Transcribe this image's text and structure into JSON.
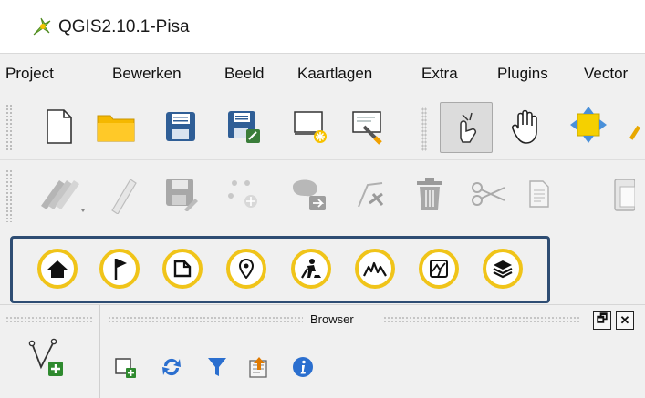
{
  "window": {
    "title": "QGIS2.10.1-Pisa",
    "app_icon": "qgis-logo-icon"
  },
  "menubar": {
    "items": [
      {
        "label": "Project"
      },
      {
        "label": "Bewerken"
      },
      {
        "label": "Beeld"
      },
      {
        "label": "Kaartlagen"
      },
      {
        "label": "Extra"
      },
      {
        "label": "Plugins"
      },
      {
        "label": "Vector"
      }
    ]
  },
  "toolbar_file": {
    "icons": [
      "new-project-icon",
      "open-folder-icon",
      "save-icon",
      "save-as-icon",
      "new-print-composer-icon",
      "composer-manager-icon",
      "touch-zoom-pan-icon",
      "pan-hand-icon",
      "pan-to-selection-icon"
    ]
  },
  "toolbar_digitize": {
    "icons": [
      "current-edits-icon",
      "toggle-editing-icon",
      "save-layer-edits-icon",
      "add-feature-icon",
      "move-feature-icon",
      "node-tool-icon",
      "delete-selected-icon",
      "cut-features-icon",
      "copy-features-icon",
      "paste-features-icon"
    ]
  },
  "toolbar_highlight": {
    "icons": [
      "home-icon",
      "flag-icon",
      "page-icon",
      "map-pin-icon",
      "worker-icon",
      "profile-peaks-icon",
      "map-sketch-icon",
      "layers-stack-icon"
    ],
    "accent": "#f0c419",
    "frame_color": "#2e4d73"
  },
  "browser_panel": {
    "title": "Browser",
    "buttons": [
      "add-selected-layers-icon",
      "refresh-icon",
      "filter-icon",
      "collapse-all-icon",
      "properties-info-icon"
    ],
    "float_label": "🗗",
    "close_label": "✕"
  },
  "left_dock": {
    "icon": "new-vector-layer-icon"
  }
}
